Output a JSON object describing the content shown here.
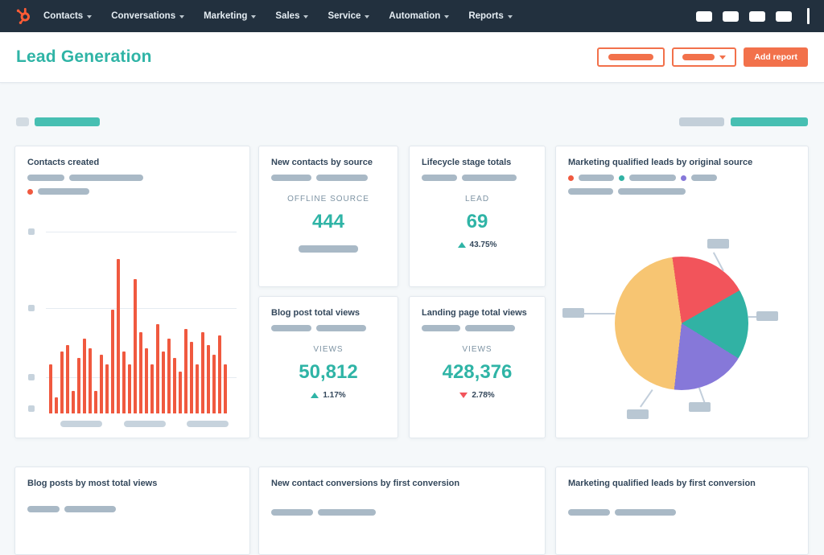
{
  "colors": {
    "navy": "#22303e",
    "orange": "#f2714b",
    "teal": "#2fb4a6",
    "teal_bar": "#47bfb2",
    "bar_orange": "#f0593f",
    "pie_yellow": "#f7c572",
    "pie_red": "#f2545b",
    "pie_teal": "#31b2a4",
    "pie_purple": "#8678d9",
    "positive": "#2fb4a6",
    "negative": "#f2545b"
  },
  "nav": {
    "items": [
      {
        "label": "Contacts"
      },
      {
        "label": "Conversations"
      },
      {
        "label": "Marketing"
      },
      {
        "label": "Sales"
      },
      {
        "label": "Service"
      },
      {
        "label": "Automation"
      },
      {
        "label": "Reports"
      }
    ]
  },
  "header": {
    "title": "Lead Generation",
    "add_report_label": "Add report"
  },
  "cards": {
    "contacts_created": {
      "title": "Contacts created",
      "chart_data": {
        "type": "bar",
        "values": [
          30,
          10,
          38,
          42,
          14,
          34,
          46,
          40,
          14,
          36,
          30,
          64,
          95,
          38,
          30,
          83,
          50,
          40,
          30,
          55,
          38,
          46,
          34,
          26,
          52,
          44,
          30,
          50,
          42,
          36,
          48,
          30
        ],
        "ylim": [
          0,
          112
        ]
      }
    },
    "new_contacts_by_source": {
      "title": "New contacts by source",
      "metric_label": "OFFLINE SOURCE",
      "value": "444"
    },
    "lifecycle_stage_totals": {
      "title": "Lifecycle stage totals",
      "metric_label": "LEAD",
      "value": "69",
      "delta": "43.75%",
      "delta_direction": "up"
    },
    "mql_by_original_source": {
      "title": "Marketing qualified leads by original source",
      "chart_data": {
        "type": "pie",
        "start_angle_deg": -8,
        "slices": [
          {
            "value": 19,
            "color": "#f2545b"
          },
          {
            "value": 17,
            "color": "#31b2a4"
          },
          {
            "value": 18,
            "color": "#8678d9"
          },
          {
            "value": 46,
            "color": "#f7c572"
          }
        ]
      }
    },
    "blog_post_total_views": {
      "title": "Blog post total views",
      "metric_label": "VIEWS",
      "value": "50,812",
      "delta": "1.17%",
      "delta_direction": "up"
    },
    "landing_page_total_views": {
      "title": "Landing page total views",
      "metric_label": "VIEWS",
      "value": "428,376",
      "delta": "2.78%",
      "delta_direction": "down"
    },
    "blog_posts_by_most_total_views": {
      "title": "Blog posts by most total views"
    },
    "new_contact_conversions_by_first_conversion": {
      "title": "New contact conversions by first conversion"
    },
    "mql_by_first_conversion": {
      "title": "Marketing qualified leads by first conversion"
    }
  }
}
